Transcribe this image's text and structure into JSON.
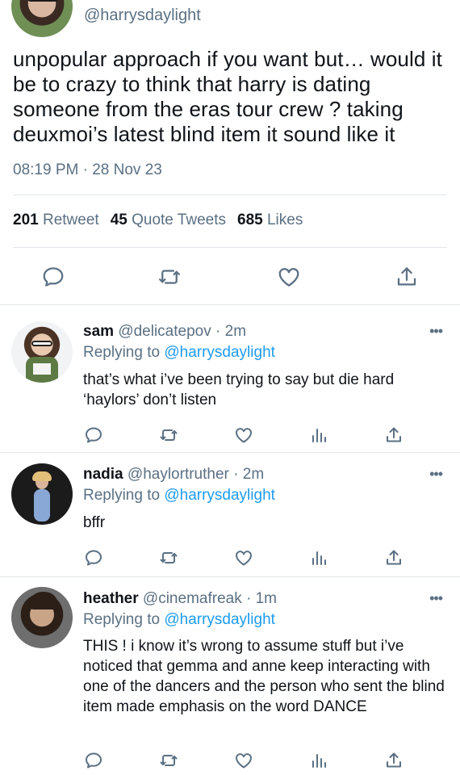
{
  "main_tweet": {
    "handle": "@harrysdaylight",
    "text": "unpopular approach if you want but… would it be to crazy to think that harry is dating someone from the eras tour crew ? taking deuxmoi’s latest blind item it sound like it",
    "timestamp": "08:19 PM · 28 Nov 23",
    "stats": {
      "retweets_count": "201",
      "retweets_label": "Retweet",
      "quotes_count": "45",
      "quotes_label": "Quote Tweets",
      "likes_count": "685",
      "likes_label": "Likes"
    },
    "actions": [
      "reply-icon",
      "retweet-icon",
      "like-icon",
      "share-icon"
    ]
  },
  "replies": [
    {
      "name": "sam",
      "handle": "@delicatepov",
      "time": "· 2m",
      "replying_prefix": "Replying to",
      "replying_to": "@harrysdaylight",
      "text": "that’s what i’ve been trying to say but die hard ‘haylors’ don’t listen",
      "more": "•••"
    },
    {
      "name": "nadia",
      "handle": "@haylortruther",
      "time": "· 2m",
      "replying_prefix": "Replying to",
      "replying_to": "@harrysdaylight",
      "text": "bffr",
      "more": "•••"
    },
    {
      "name": "heather",
      "handle": "@cinemafreak",
      "time": "· 1m",
      "replying_prefix": "Replying to",
      "replying_to": "@harrysdaylight",
      "text": "THIS ! i know it’s wrong to assume stuff but i’ve noticed that gemma and anne keep interacting with one of the dancers and the person who sent the blind item made emphasis on the word DANCE",
      "more": "•••"
    }
  ],
  "reply_actions": [
    "reply-icon",
    "retweet-icon",
    "like-icon",
    "analytics-icon",
    "share-icon"
  ],
  "colors": {
    "text": "#0f1419",
    "muted": "#5b7083",
    "link": "#1d9bf0",
    "divider": "#e1e6ea"
  }
}
